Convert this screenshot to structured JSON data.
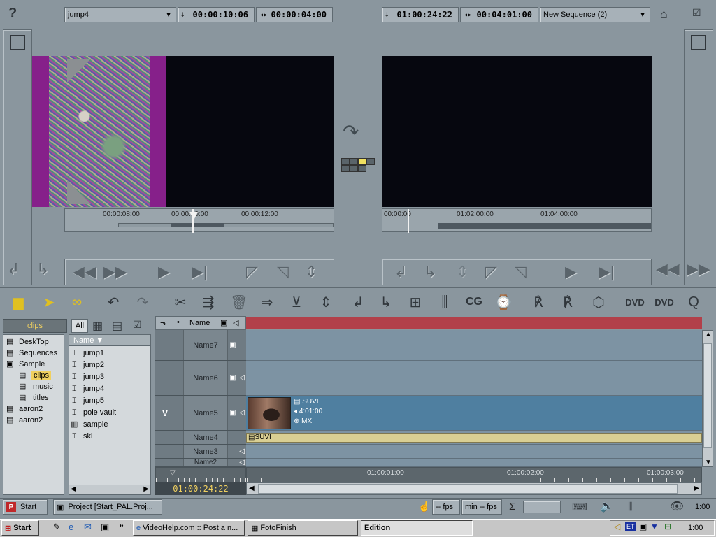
{
  "top_bar": {
    "source_clip": "jump4",
    "source_tc1": "00:00:10:06",
    "source_tc2": "00:00:04:00",
    "record_tc1": "01:00:24:22",
    "record_tc2": "00:04:01:00",
    "sequence": "New Sequence (2)"
  },
  "source_scrub": {
    "t1": "00:00:08:00",
    "t2": "00:00:10:00",
    "t3": "00:00:12:00"
  },
  "record_scrub": {
    "t1": "00:00:00",
    "t2": "01:02:00:00",
    "t3": "01:04:00:00"
  },
  "bin": {
    "title": "clips",
    "tab_all": "All",
    "tree": [
      "DeskTop",
      "Sequences",
      "Sample",
      "clips",
      "music",
      "titles",
      "aaron2",
      "aaron2"
    ],
    "list_header": "Name ▼",
    "items": [
      "jump1",
      "jump2",
      "jump3",
      "jump4",
      "jump5",
      "pole vault",
      "sample",
      "ski"
    ]
  },
  "timeline": {
    "header_name": "Name",
    "tracks": [
      "Name7",
      "Name6",
      "Name5",
      "Name4",
      "Name3",
      "Name2"
    ],
    "v_label": "V",
    "clip_lines": [
      "SUVI",
      "4:01:00",
      "MX"
    ],
    "audio_clip": "SUVI",
    "ruler": [
      "01:00:01:00",
      "01:00:02:00",
      "01:00:03:00"
    ],
    "current_tc": "01:00:24:22"
  },
  "status_bar": {
    "start": "Start",
    "project": "Project [Start_PAL.Proj...",
    "fps1": "-- fps",
    "fps2": "min -- fps",
    "sigma": "Σ",
    "time": "1:00"
  },
  "taskbar": {
    "start": "Start",
    "arrows": "»",
    "items": [
      "VideoHelp.com :: Post a n...",
      "FotoFinish",
      "Edition"
    ],
    "clock": "1:00",
    "tray_et": "ET"
  },
  "colors": {
    "accent_red": "#b2404a",
    "clip_blue": "#4f7fa0",
    "audio_tan": "#d9cf93",
    "tc_yellow": "#f0d060"
  }
}
